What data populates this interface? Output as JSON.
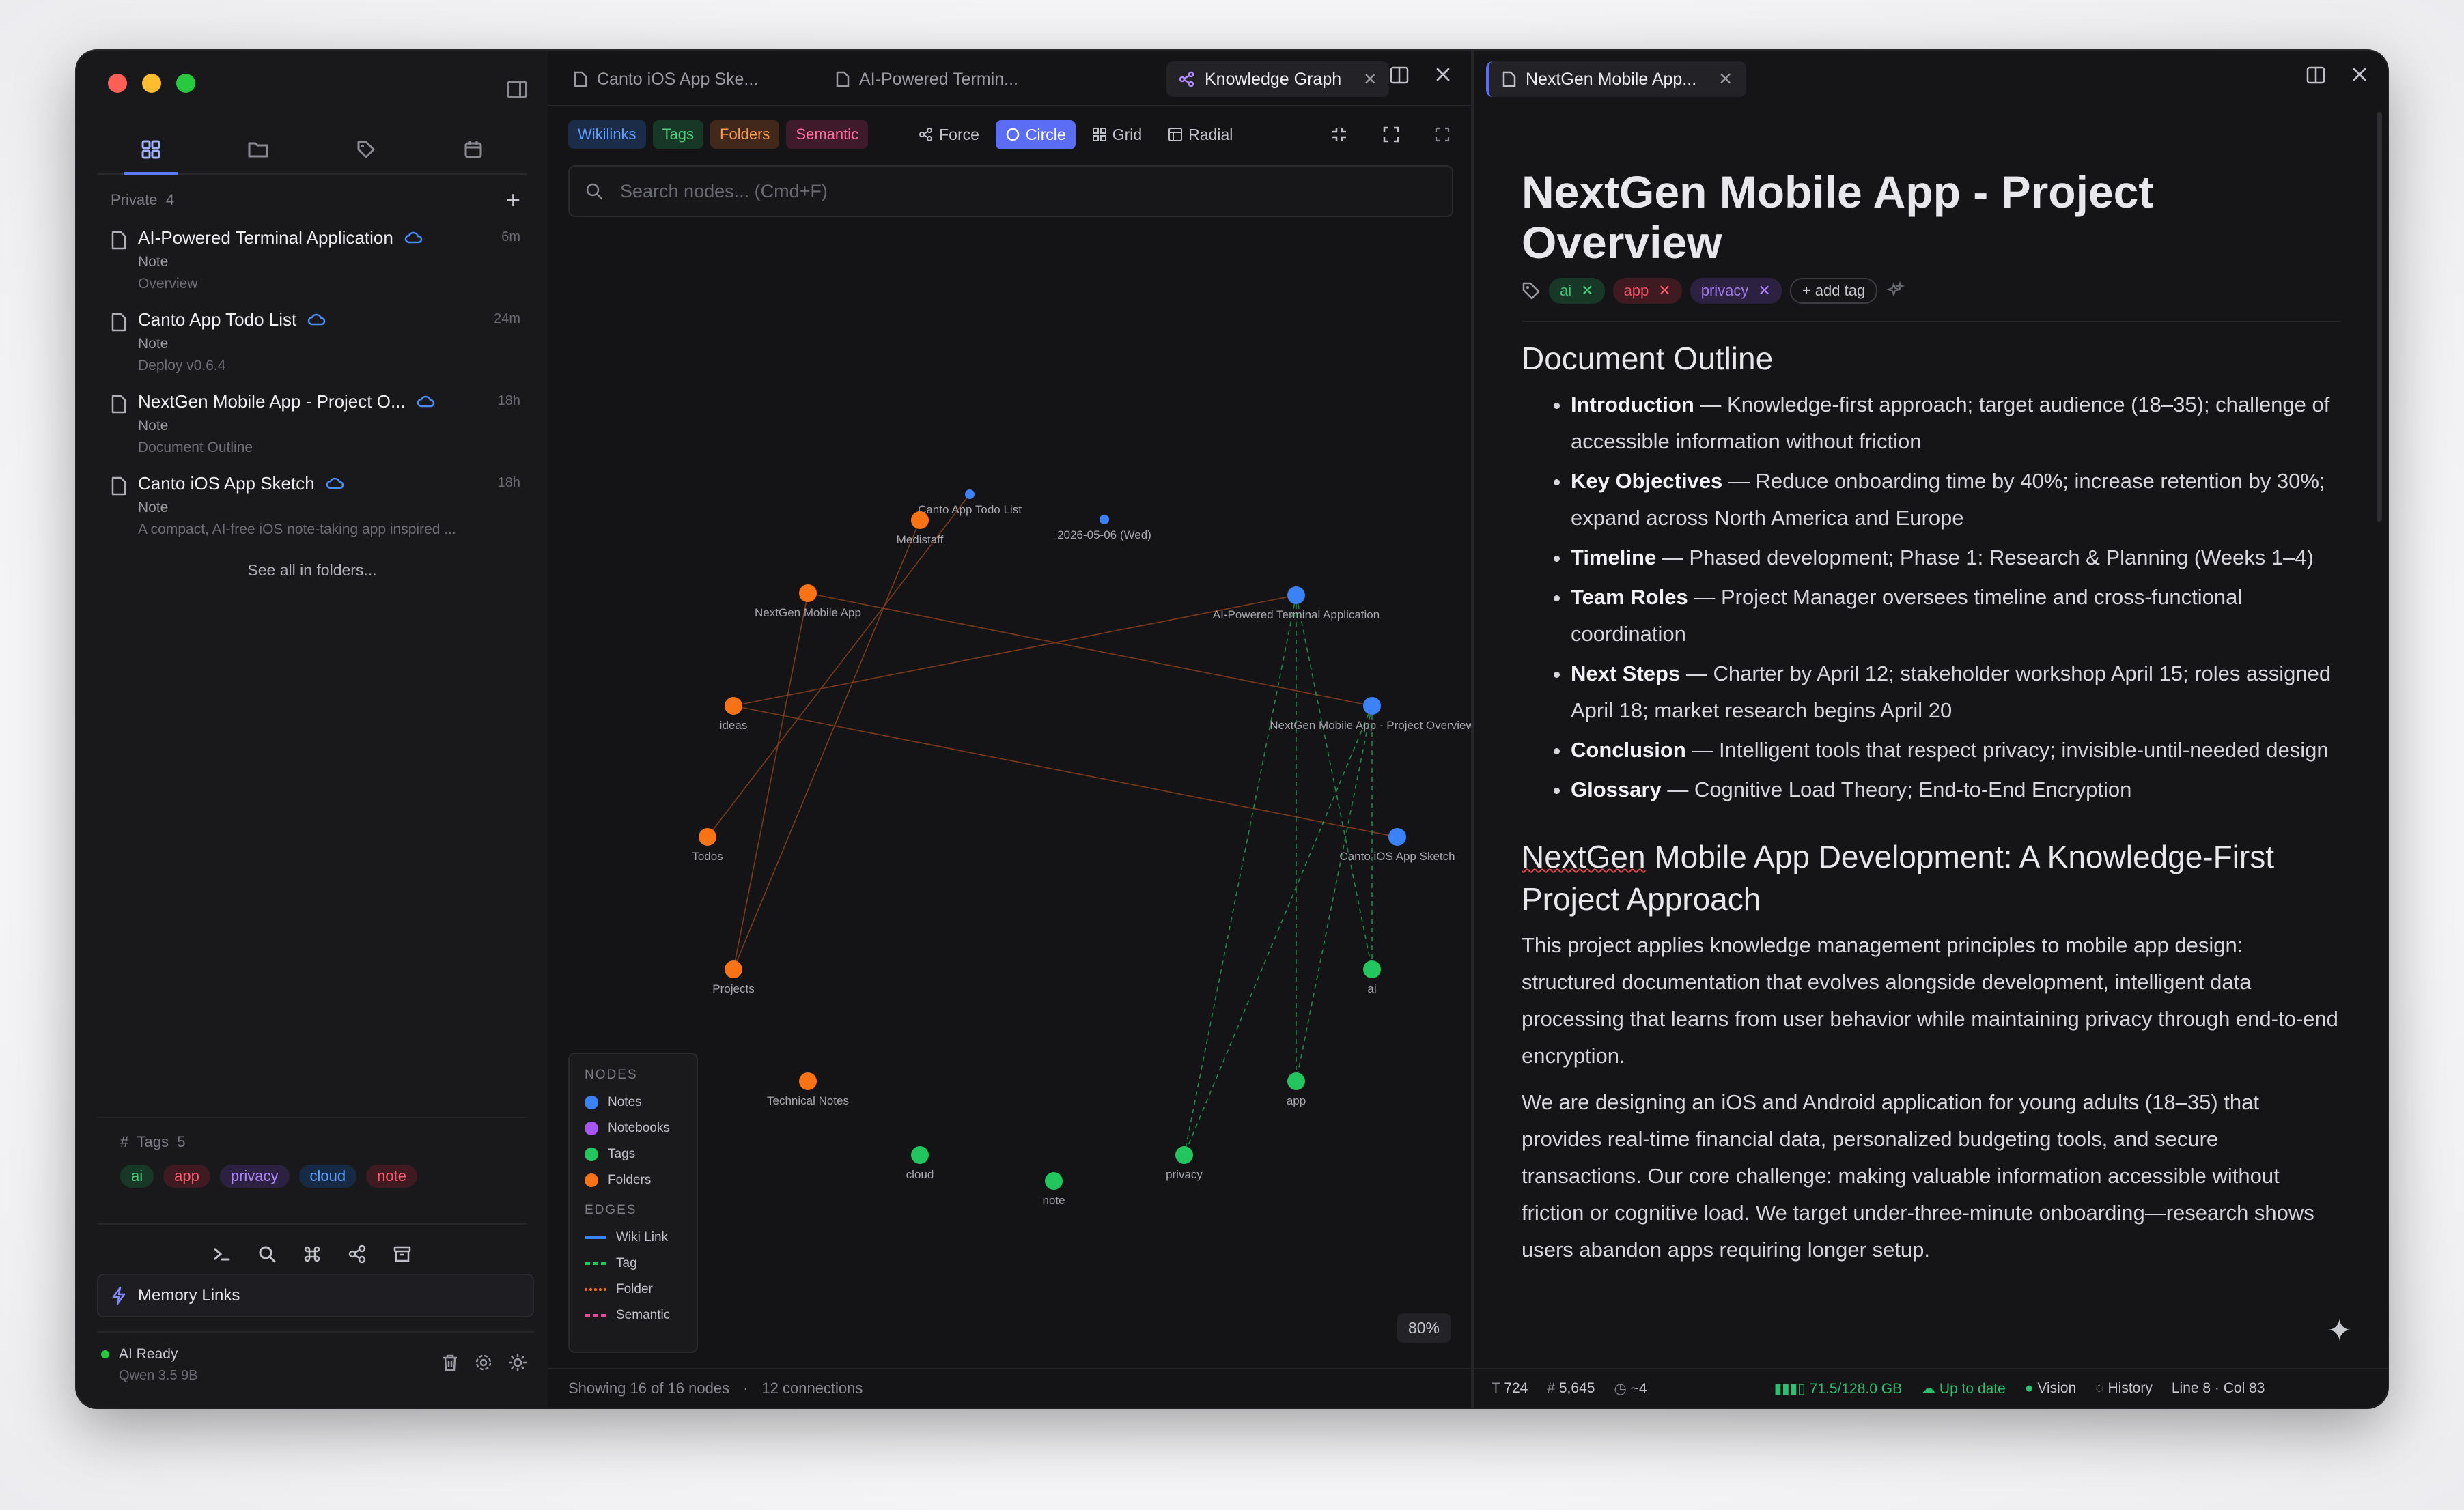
{
  "sidebar": {
    "section_label": "Private",
    "section_count": "4",
    "add_label": "+",
    "files": [
      {
        "title": "AI-Powered Terminal Application",
        "time": "6m",
        "type": "Note",
        "preview": "Overview"
      },
      {
        "title": "Canto App Todo List",
        "time": "24m",
        "type": "Note",
        "preview": "Deploy v0.6.4"
      },
      {
        "title": "NextGen Mobile App - Project O...",
        "time": "18h",
        "type": "Note",
        "preview": "Document Outline"
      },
      {
        "title": "Canto iOS App Sketch",
        "time": "18h",
        "type": "Note",
        "preview": "A compact, AI-free iOS note-taking app inspired ..."
      }
    ],
    "see_all": "See all in folders...",
    "tags_label": "Tags",
    "tags_count": "5",
    "tags": [
      "ai",
      "app",
      "privacy",
      "cloud",
      "note"
    ],
    "memory_links": "Memory Links",
    "ai_status": "AI Ready",
    "model": "Qwen 3.5 9B"
  },
  "graph_panel": {
    "tabs": [
      "Canto iOS App Ske...",
      "AI-Powered Termin...",
      "Knowledge Graph"
    ],
    "filters": [
      "Wikilinks",
      "Tags",
      "Folders",
      "Semantic"
    ],
    "layouts": [
      "Force",
      "Circle",
      "Grid",
      "Radial"
    ],
    "search_placeholder": "Search nodes... (Cmd+F)",
    "legend": {
      "nodes_title": "NODES",
      "nodes": [
        {
          "label": "Notes",
          "color": "#3b82f6"
        },
        {
          "label": "Notebooks",
          "color": "#a855f7"
        },
        {
          "label": "Tags",
          "color": "#22c55e"
        },
        {
          "label": "Folders",
          "color": "#f97316"
        }
      ],
      "edges_title": "EDGES",
      "edges": [
        {
          "label": "Wiki Link",
          "color": "#3b82f6",
          "style": "solid"
        },
        {
          "label": "Tag",
          "color": "#22c55e",
          "style": "dashed"
        },
        {
          "label": "Folder",
          "color": "#f97316",
          "style": "dotted"
        },
        {
          "label": "Semantic",
          "color": "#ec4899",
          "style": "dashed"
        }
      ]
    },
    "zoom": "80%",
    "status_nodes": "Showing 16 of 16 nodes",
    "status_sep": "·",
    "status_connections": "12 connections",
    "nodes": [
      {
        "id": "canto-todo",
        "label": "Canto App Todo List",
        "kind": "note"
      },
      {
        "id": "date",
        "label": "2026-05-06 (Wed)",
        "kind": "note"
      },
      {
        "id": "medistaff",
        "label": "Medistaff",
        "kind": "folder"
      },
      {
        "id": "nextgen-app",
        "label": "NextGen Mobile App",
        "kind": "folder"
      },
      {
        "id": "ai-terminal",
        "label": "AI-Powered Terminal Application",
        "kind": "note"
      },
      {
        "id": "ideas",
        "label": "ideas",
        "kind": "folder"
      },
      {
        "id": "nextgen-overview",
        "label": "NextGen Mobile App - Project Overview",
        "kind": "note"
      },
      {
        "id": "todos",
        "label": "Todos",
        "kind": "folder"
      },
      {
        "id": "canto-sketch",
        "label": "Canto iOS App Sketch",
        "kind": "note"
      },
      {
        "id": "projects",
        "label": "Projects",
        "kind": "folder"
      },
      {
        "id": "ai",
        "label": "ai",
        "kind": "tag"
      },
      {
        "id": "technical",
        "label": "Technical Notes",
        "kind": "folder"
      },
      {
        "id": "app",
        "label": "app",
        "kind": "tag"
      },
      {
        "id": "cloud",
        "label": "cloud",
        "kind": "tag"
      },
      {
        "id": "privacy",
        "label": "privacy",
        "kind": "tag"
      },
      {
        "id": "note",
        "label": "note",
        "kind": "tag"
      }
    ],
    "edges": [
      {
        "from": "nextgen-app",
        "to": "nextgen-overview",
        "kind": "folder"
      },
      {
        "from": "ideas",
        "to": "ai-terminal",
        "kind": "folder"
      },
      {
        "from": "ideas",
        "to": "canto-sketch",
        "kind": "folder"
      },
      {
        "from": "todos",
        "to": "canto-todo",
        "kind": "folder"
      },
      {
        "from": "projects",
        "to": "medistaff",
        "kind": "folder"
      },
      {
        "from": "projects",
        "to": "nextgen-app",
        "kind": "folder"
      },
      {
        "from": "ai-terminal",
        "to": "ai",
        "kind": "tag"
      },
      {
        "from": "ai-terminal",
        "to": "app",
        "kind": "tag"
      },
      {
        "from": "ai-terminal",
        "to": "privacy",
        "kind": "tag"
      },
      {
        "from": "nextgen-overview",
        "to": "ai",
        "kind": "tag"
      },
      {
        "from": "nextgen-overview",
        "to": "app",
        "kind": "tag"
      },
      {
        "from": "nextgen-overview",
        "to": "privacy",
        "kind": "tag"
      }
    ]
  },
  "doc_panel": {
    "tab": "NextGen Mobile App...",
    "title": "NextGen Mobile App - Project Overview",
    "tags": [
      {
        "label": "ai",
        "color": "green"
      },
      {
        "label": "app",
        "color": "red"
      },
      {
        "label": "privacy",
        "color": "purple"
      }
    ],
    "add_tag": "+ add tag",
    "outline_heading": "Document Outline",
    "bullets": [
      {
        "bold": "Introduction",
        "text": " — Knowledge-first approach; target audience (18–35); challenge of accessible information without friction"
      },
      {
        "bold": "Key Objectives",
        "text": " — Reduce onboarding time by 40%; increase retention by 30%; expand across North America and Europe"
      },
      {
        "bold": "Timeline",
        "text": " — Phased development; Phase 1: Research & Planning (Weeks 1–4)"
      },
      {
        "bold": "Team Roles",
        "text": " — Project Manager oversees timeline and cross-functional coordination"
      },
      {
        "bold": "Next Steps",
        "text": " — Charter by April 12; stakeholder workshop April 15; roles assigned April 18; market research begins April 20"
      },
      {
        "bold": "Conclusion",
        "text": " — Intelligent tools that respect privacy; invisible-until-needed design"
      },
      {
        "bold": "Glossary",
        "text": " — Cognitive Load Theory; End-to-End Encryption"
      }
    ],
    "section_heading_word": "NextGen",
    "section_heading_rest": " Mobile App Development: A Knowledge-First Project Approach",
    "paragraphs": [
      "This project applies knowledge management principles to mobile app design: structured documentation that evolves alongside development, intelligent data processing that learns from user behavior while maintaining privacy through end-to-end encryption.",
      "We are designing an iOS and Android application for young adults (18–35) that provides real-time financial data, personalized budgeting tools, and secure transactions. Our core challenge: making valuable information accessible without friction or cognitive load. We target under-three-minute onboarding—research shows users abandon apps requiring longer setup."
    ],
    "status": {
      "chars": "724",
      "words": "5,645",
      "read": "~4",
      "memory": "71.5/128.0 GB",
      "sync": "Up to date",
      "vision": "Vision",
      "history": "History",
      "position": "Line 8 · Col 83"
    }
  }
}
